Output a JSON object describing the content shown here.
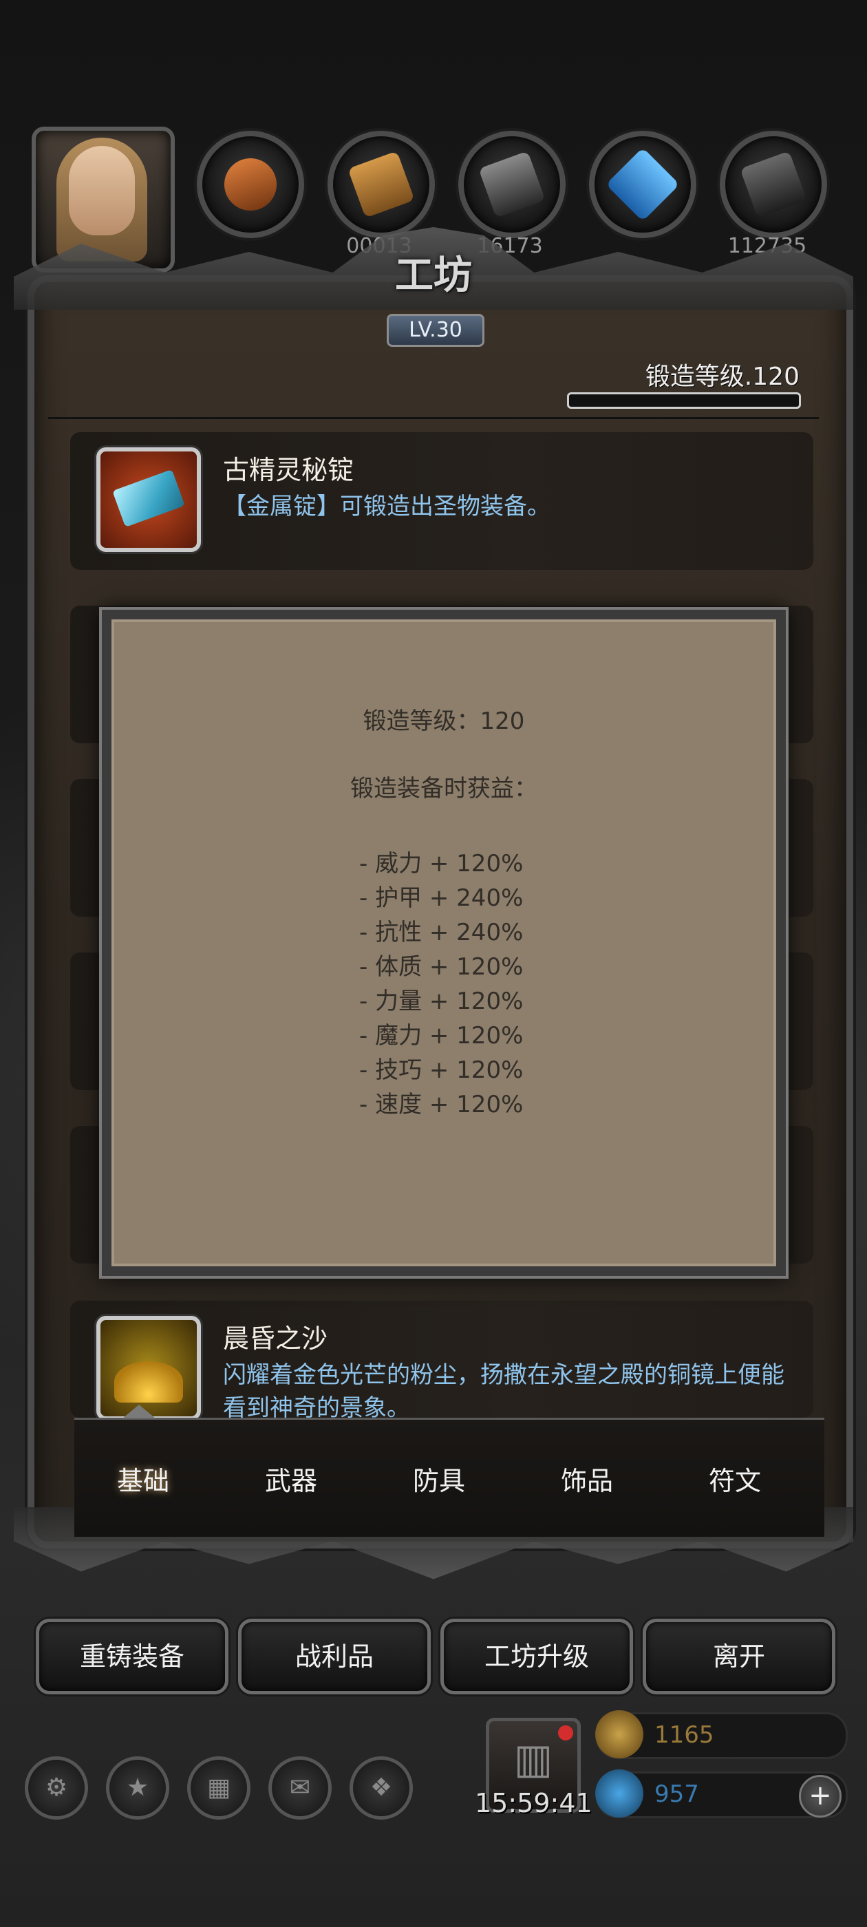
{
  "header": {
    "title": "工坊",
    "level_badge": "LV.30",
    "forge_level_label": "锻造等级.120",
    "exp_progress": 0.0
  },
  "resources": [
    {
      "name": "copper-ore-icon",
      "count": ""
    },
    {
      "name": "wood-plank-icon",
      "count": "00013"
    },
    {
      "name": "iron-ingot-icon",
      "count": "16173"
    },
    {
      "name": "crystal-icon",
      "count": ""
    },
    {
      "name": "steel-ingot-icon",
      "count": "112735"
    }
  ],
  "items": [
    {
      "name": "古精灵秘锭",
      "desc": "【金属锭】可锻造出圣物装备。",
      "icon": "ingot-icon",
      "icon_color": "#6fd0e8",
      "frame_color": "#b4381c"
    },
    {
      "name": "晨昏之沙",
      "desc": "闪耀着金色光芒的粉尘，扬撒在永望之殿的铜镜上便能看到神奇的景象。",
      "icon": "sand-icon",
      "icon_color": "#e3a720",
      "frame_color": "#7a5e12"
    }
  ],
  "tooltip": {
    "forge_level_line": "锻造等级：120",
    "bonus_title": "锻造装备时获益：",
    "bonuses": [
      "- 威力 + 120%",
      "- 护甲 + 240%",
      "- 抗性 + 240%",
      "- 体质 + 120%",
      "- 力量 + 120%",
      "- 魔力 + 120%",
      "- 技巧 + 120%",
      "- 速度 + 120%"
    ]
  },
  "tabs": [
    "基础",
    "武器",
    "防具",
    "饰品",
    "符文"
  ],
  "actions": [
    "重铸装备",
    "战利品",
    "工坊升级",
    "离开"
  ],
  "hud": {
    "timer": "15:59:41",
    "gold": "1165",
    "gems": "957",
    "gold_color": "#c9a24a",
    "gem_color": "#4aa6e6"
  }
}
